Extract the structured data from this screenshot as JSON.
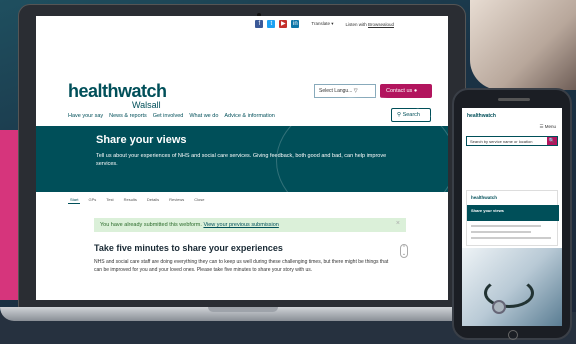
{
  "laptop": {
    "topbar": {
      "social": [
        {
          "name": "facebook-icon",
          "glyph": "f",
          "color": "#3b5998"
        },
        {
          "name": "twitter-icon",
          "glyph": "t",
          "color": "#1da1f2"
        },
        {
          "name": "youtube-icon",
          "glyph": "▶",
          "color": "#c4302b"
        },
        {
          "name": "linkedin-icon",
          "glyph": "in",
          "color": "#0e76a8"
        }
      ],
      "translate_label": "Translate ▾",
      "listen_text": "Listen with ",
      "listen_link": "Browsealoud"
    },
    "header": {
      "logo_text": "healthwatch",
      "logo_sub": "Walsall",
      "language_select": "Select Langu...",
      "contact_button": "Contact us",
      "search_button": "Search",
      "nav": [
        "Have your say",
        "News & reports",
        "Get involved",
        "What we do",
        "Advice & information"
      ]
    },
    "hero": {
      "title": "Share your views",
      "description": "Tell us about your experiences of NHS and social care services. Giving feedback, both good and bad, can help improve services."
    },
    "tabs": [
      "Start",
      "GPs",
      "Test",
      "Results",
      "Details",
      "Reviews",
      "Close"
    ],
    "notice": {
      "text": "You have already submitted this webform. ",
      "link": "View your previous submission",
      "close": "×"
    },
    "section_title": "Take five minutes to share your experiences",
    "body_text": "NHS and social care staff are doing everything they can to keep us well during these challenging times, but there might be things that can be improved for you and your loved ones. Please take five minutes to share your story with us."
  },
  "phone": {
    "menu_label": "☰ Menu",
    "search_placeholder": "Search by service name or location",
    "search_button": "🔍",
    "logo_text": "healthwatch",
    "inner_logo": "healthwatch",
    "inner_hero_title": "Share your views"
  },
  "colors": {
    "brand_teal": "#004f59",
    "brand_pink": "#b2155e",
    "notice_bg": "#dbf0d9"
  }
}
